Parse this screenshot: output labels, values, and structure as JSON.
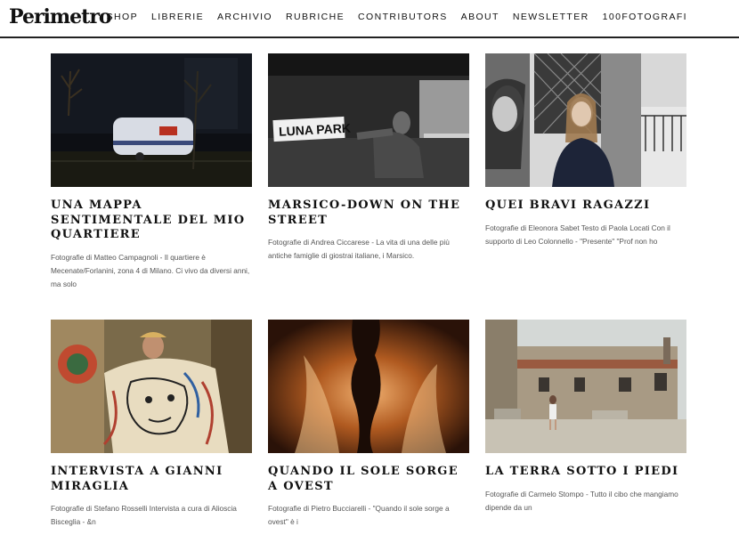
{
  "header": {
    "logo": "Perimetro",
    "nav": [
      "SHOP",
      "LIBRERIE",
      "ARCHIVIO",
      "RUBRICHE",
      "CONTRIBUTORS",
      "ABOUT",
      "NEWSLETTER",
      "100FOTOGRAFI"
    ]
  },
  "articles": [
    {
      "title": "UNA MAPPA SENTIMENTALE DEL MIO QUARTIERE",
      "excerpt": "Fotografie di Matteo Campagnoli - Il quartiere è Mecenate/Forlanini, zona 4 di Milano. Ci vivo da diversi anni, ma solo",
      "image": "night-caravan-photo"
    },
    {
      "title": "MARSICO-DOWN ON THE STREET",
      "excerpt": "Fotografie di Andrea Ciccarese - La vita di una delle più antiche famiglie di giostrai italiane, i Marsico.",
      "image": "luna-park-truck-photo",
      "sign_text": "LUNA PARK"
    },
    {
      "title": "QUEI BRAVI RAGAZZI",
      "excerpt": "Fotografie di Eleonora Sabet Testo di Paola Locati Con il supporto di Leo Colonnello    - \"Presente\" \"Prof non ho",
      "image": "two-girls-portrait-photo"
    },
    {
      "title": "INTERVISTA A GIANNI MIRAGLIA",
      "excerpt": "Fotografie di Stefano Rosselli Intervista a cura di Alioscia Bisceglia -   &n",
      "image": "artist-painting-photo"
    },
    {
      "title": "QUANDO IL SOLE SORGE A OVEST",
      "excerpt": "Fotografie di Pietro Bucciarelli   - \"Quando il sole sorge a ovest\" è i",
      "image": "fire-silhouette-photo"
    },
    {
      "title": "LA TERRA SOTTO I PIEDI",
      "excerpt": "Fotografie di Carmelo Stompo - Tutto il cibo che mangiamo dipende da un",
      "image": "village-girl-photo"
    }
  ]
}
